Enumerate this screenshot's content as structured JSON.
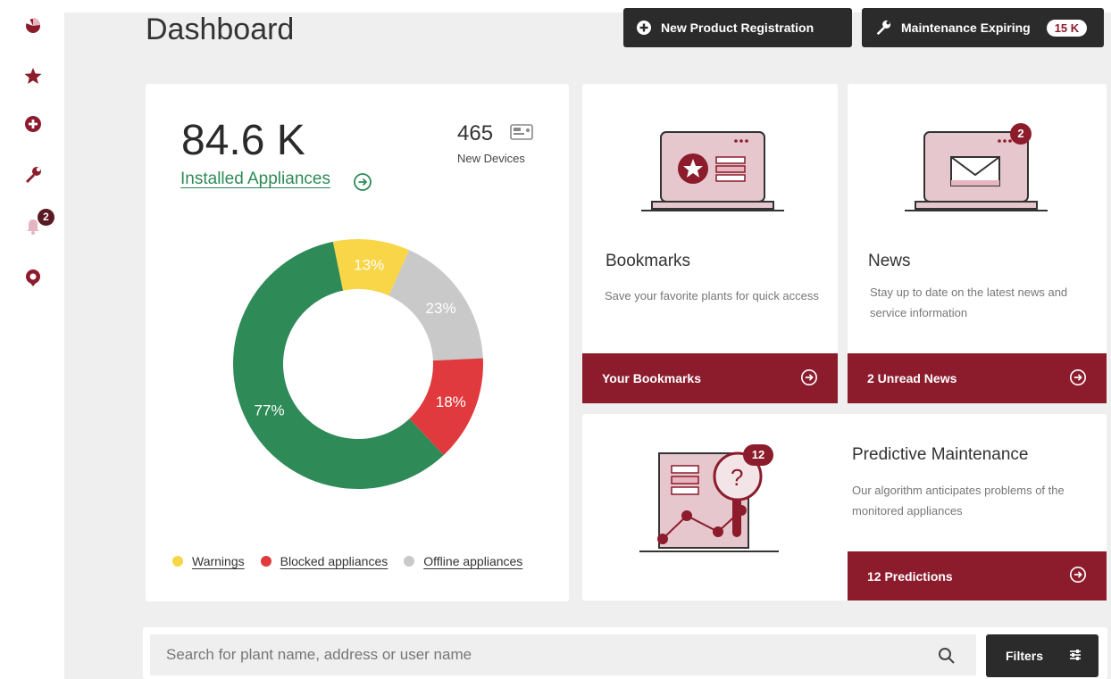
{
  "header": {
    "title": "Dashboard",
    "new_product_label": "New Product Registration",
    "maintenance_label": "Maintenance Expiring",
    "maintenance_count": "15 K"
  },
  "sidebar": {
    "items": [
      {
        "icon": "pie-chart-icon"
      },
      {
        "icon": "star-icon"
      },
      {
        "icon": "plus-circle-icon"
      },
      {
        "icon": "wrench-icon"
      },
      {
        "icon": "bell-icon",
        "badge": "2"
      },
      {
        "icon": "location-pin-icon"
      }
    ]
  },
  "appliances": {
    "total": "84.6 K",
    "link_label": "Installed Appliances",
    "new_devices_count": "465",
    "new_devices_label": "New Devices"
  },
  "chart_data": {
    "type": "pie",
    "variant": "donut",
    "slices": [
      {
        "label": "77%",
        "value": 77,
        "color": "#2e8b57"
      },
      {
        "label": "13%",
        "value": 13,
        "color": "#f9d548"
      },
      {
        "label": "23%",
        "value": 23,
        "color": "#c9c9c9"
      },
      {
        "label": "18%",
        "value": 18,
        "color": "#e03a3e"
      }
    ],
    "legend": [
      {
        "label": "Warnings",
        "color": "#f9d548"
      },
      {
        "label": "Blocked appliances",
        "color": "#e03a3e"
      },
      {
        "label": "Offline appliances",
        "color": "#c9c9c9"
      }
    ]
  },
  "bookmarks": {
    "title": "Bookmarks",
    "description": "Save your favorite plants for quick access",
    "cta": "Your Bookmarks"
  },
  "news": {
    "title": "News",
    "description": "Stay up to date on the latest news and service information",
    "cta": "2 Unread News",
    "badge": "2"
  },
  "predictive": {
    "title": "Predictive Maintenance",
    "description": "Our algorithm anticipates problems of the monitored appliances",
    "cta": "12 Predictions",
    "badge": "12"
  },
  "search": {
    "placeholder": "Search for plant name, address or user name",
    "filters_label": "Filters"
  },
  "colors": {
    "brand": "#8c1c2c",
    "dark": "#2b2b2b",
    "green": "#2e8b57"
  }
}
